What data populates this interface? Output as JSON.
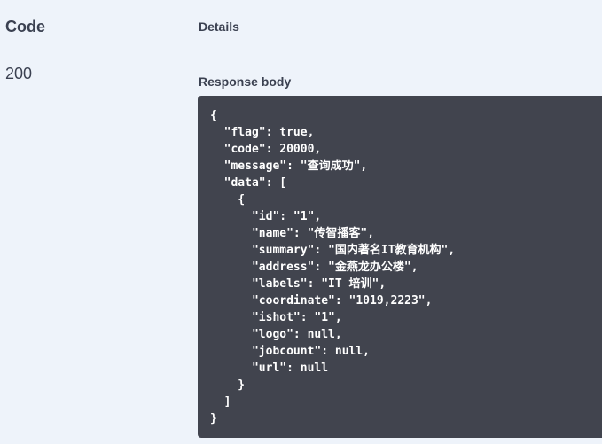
{
  "table": {
    "code_header": "Code",
    "details_header": "Details",
    "row": {
      "code": "200",
      "response_body_label": "Response body",
      "response_body_text": "{\n  \"flag\": true,\n  \"code\": 20000,\n  \"message\": \"查询成功\",\n  \"data\": [\n    {\n      \"id\": \"1\",\n      \"name\": \"传智播客\",\n      \"summary\": \"国内著名IT教育机构\",\n      \"address\": \"金燕龙办公楼\",\n      \"labels\": \"IT 培训\",\n      \"coordinate\": \"1019,2223\",\n      \"ishot\": \"1\",\n      \"logo\": null,\n      \"jobcount\": null,\n      \"url\": null\n    }\n  ]\n}"
    }
  },
  "colors": {
    "page_background": "#eef3fa",
    "code_background": "#41444e",
    "text": "#3b4151",
    "divider": "#c9d1db"
  }
}
